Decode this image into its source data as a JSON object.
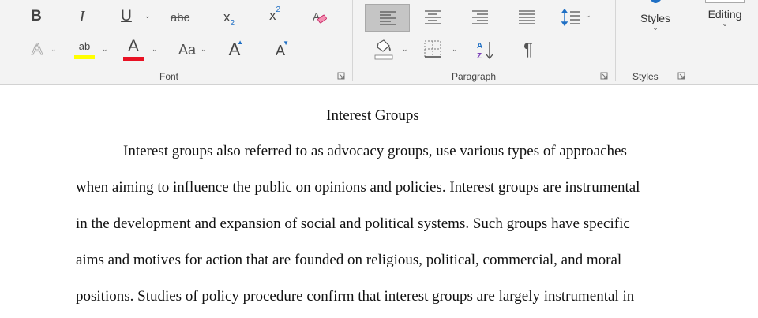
{
  "ribbon": {
    "font_group": {
      "label": "Font",
      "bold": "B",
      "italic": "I",
      "underline": "U",
      "strikethrough": "abc",
      "subscript_base": "x",
      "subscript_mark": "2",
      "superscript_base": "x",
      "superscript_mark": "2",
      "text_effects": "A",
      "highlight": "ab",
      "highlight_color": "#ffff00",
      "font_color_letter": "A",
      "font_color": "#e81123",
      "change_case": "Aa",
      "grow_font": "A",
      "shrink_font": "A"
    },
    "paragraph_group": {
      "label": "Paragraph",
      "pilcrow": "¶"
    },
    "styles_group": {
      "label": "Styles",
      "button_label": "Styles"
    },
    "editing_group": {
      "button_label": "Editing"
    }
  },
  "document": {
    "title": "Interest Groups",
    "lines": [
      "Interest groups also referred to as advocacy groups, use various types of approaches",
      "when aiming to influence the public on opinions and policies. Interest groups are instrumental",
      "in the development and expansion of social and political systems. Such groups have specific",
      "aims and motives for action that are founded on religious, political, commercial, and moral",
      "positions. Studies of policy procedure confirm that interest groups are largely instrumental in"
    ]
  }
}
